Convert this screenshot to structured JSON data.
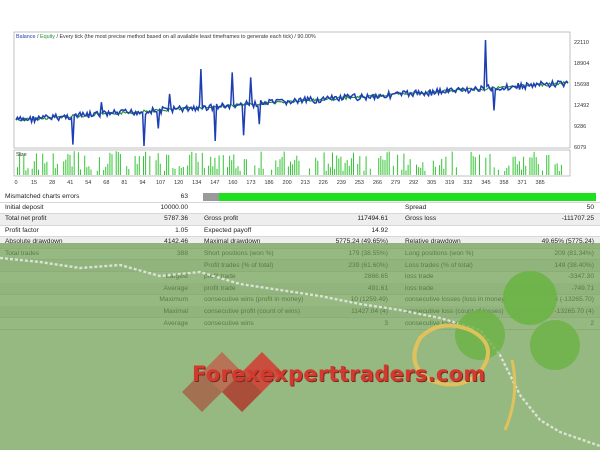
{
  "chart": {
    "legend_balance": "Balance",
    "legend_sep1": " / ",
    "legend_equity": "Equity",
    "legend_rest": " / Every tick (the most precise method based on all available least timeframes to generate each tick) / 90.00%",
    "size_label": "Size",
    "y_ticks": [
      "22110",
      "18904",
      "15698",
      "12492",
      "9286",
      "6079"
    ],
    "x_ticks": [
      "0",
      "15",
      "28",
      "41",
      "54",
      "68",
      "81",
      "94",
      "107",
      "120",
      "134",
      "147",
      "160",
      "173",
      "186",
      "200",
      "213",
      "226",
      "239",
      "253",
      "266",
      "279",
      "292",
      "305",
      "319",
      "332",
      "345",
      "358",
      "371",
      "385"
    ],
    "colors": {
      "balance": "#1d3fb3",
      "equity": "#1d8f2a",
      "size_bars": "#36c436"
    }
  },
  "report": {
    "mismatch": {
      "label": "Mismatched charts errors",
      "value": "63",
      "progress_fraction": 1.0
    },
    "rows": [
      {
        "c1": "Initial deposit",
        "v1": "10000.00",
        "c2": "",
        "v2": "",
        "c3": "Spread",
        "v3": "50"
      },
      {
        "c1": "Total net profit",
        "v1": "5787.36",
        "c2": "Gross profit",
        "v2": "117494.61",
        "c3": "Gross loss",
        "v3": "-111707.25"
      },
      {
        "c1": "Profit factor",
        "v1": "1.05",
        "c2": "Expected payoff",
        "v2": "14.92",
        "c3": "",
        "v3": ""
      },
      {
        "c1": "Absolute drawdown",
        "v1": "4142.46",
        "c2": "Maximal drawdown",
        "v2": "5775.24 (49.65%)",
        "c3": "Relative drawdown",
        "v3": "49.65% (5775.24)"
      },
      {
        "c1": "Total trades",
        "v1": "388",
        "c2": "Short positions (won %)",
        "v2": "179 (38.55%)",
        "c3": "Long positions (won %)",
        "v3": "209 (81.34%)"
      },
      {
        "c1": "",
        "v1": "",
        "c2": "Profit trades (% of total)",
        "v2": "239 (61.60%)",
        "c3": "Loss trades (% of total)",
        "v3": "149 (38.40%)"
      },
      {
        "c1": "Largest",
        "v1": "",
        "c2": "profit trade",
        "v2": "2866.65",
        "c3": "loss trade",
        "v3": "-3347.30"
      },
      {
        "c1": "Average",
        "v1": "",
        "c2": "profit trade",
        "v2": "491.61",
        "c3": "loss trade",
        "v3": "-749.71"
      },
      {
        "c1": "Maximum",
        "v1": "",
        "c2": "consecutive wins (profit in money)",
        "v2": "10 (1259.49)",
        "c3": "consecutive losses (loss in money)",
        "v3": "4 (-13265.70)"
      },
      {
        "c1": "Maximal",
        "v1": "",
        "c2": "consecutive profit (count of wins)",
        "v2": "11427.04 (4)",
        "c3": "consecutive loss (count of losses)",
        "v3": "-13265.70 (4)"
      },
      {
        "c1": "Average",
        "v1": "",
        "c2": "consecutive wins",
        "v2": "3",
        "c3": "consecutive losses",
        "v3": "2"
      }
    ]
  },
  "watermark": {
    "text": "Forexexperttraders.com"
  }
}
